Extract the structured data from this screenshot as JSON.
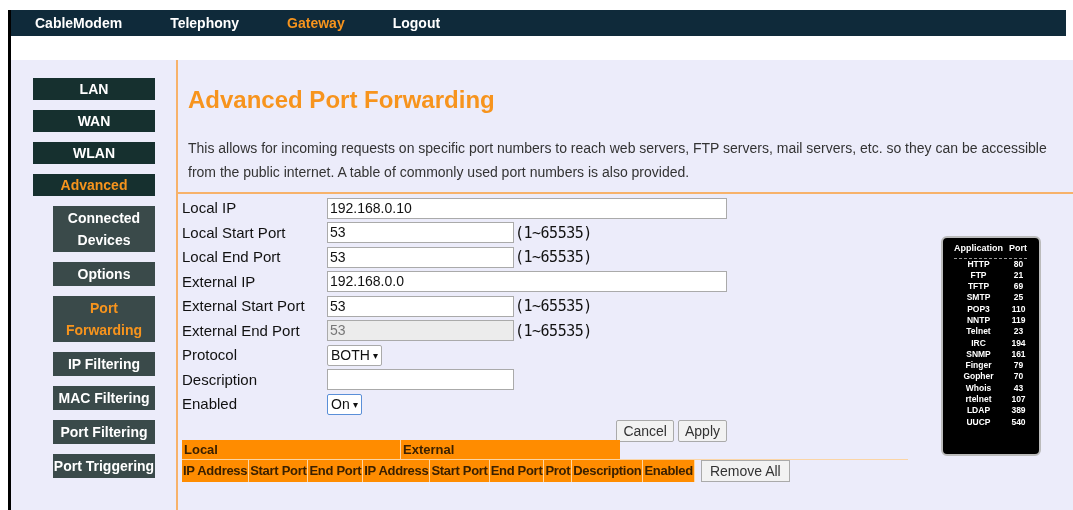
{
  "nav": [
    {
      "label": "CableModem",
      "selected": false
    },
    {
      "label": "Telephony",
      "selected": false
    },
    {
      "label": "Gateway",
      "selected": true
    },
    {
      "label": "Logout",
      "selected": false
    }
  ],
  "sidebar": {
    "items": [
      {
        "label": "LAN",
        "selected": false
      },
      {
        "label": "WAN",
        "selected": false
      },
      {
        "label": "WLAN",
        "selected": false
      },
      {
        "label": "Advanced",
        "selected": true,
        "children": [
          {
            "label": "Connected Devices",
            "selected": false
          },
          {
            "label": "Options",
            "selected": false
          },
          {
            "label": "Port Forwarding",
            "selected": true
          },
          {
            "label": "IP Filtering",
            "selected": false
          },
          {
            "label": "MAC Filtering",
            "selected": false
          },
          {
            "label": "Port Filtering",
            "selected": false
          },
          {
            "label": "Port Triggering",
            "selected": false
          }
        ]
      }
    ]
  },
  "title": "Advanced Port Forwarding",
  "description": "This allows for incoming requests on specific port numbers to reach web servers, FTP servers, mail servers, etc. so they can be accessible from the public internet. A table of commonly used port numbers is also provided.",
  "form": [
    {
      "label": "Local IP",
      "kind": "wide",
      "value": "192.168.0.10",
      "disabled": false,
      "focused": false
    },
    {
      "label": "Local Start Port",
      "kind": "text",
      "value": "53",
      "hint": "(1~65535)",
      "disabled": false,
      "focused": false
    },
    {
      "label": "Local End Port",
      "kind": "text",
      "value": "53",
      "hint": "(1~65535)",
      "disabled": false,
      "focused": false
    },
    {
      "label": "External IP",
      "kind": "wide",
      "value": "192.168.0.0",
      "disabled": false,
      "focused": false
    },
    {
      "label": "External Start Port",
      "kind": "text",
      "value": "53",
      "hint": "(1~65535)",
      "disabled": false,
      "focused": false
    },
    {
      "label": "External End Port",
      "kind": "text",
      "value": "53",
      "hint": "(1~65535)",
      "disabled": true,
      "focused": false
    },
    {
      "label": "Protocol",
      "kind": "select",
      "value": "BOTH",
      "arrow": "▾",
      "disabled": false,
      "focused": false
    },
    {
      "label": "Description",
      "kind": "text",
      "disabled": false,
      "focused": false
    },
    {
      "label": "Enabled",
      "kind": "select",
      "value": "On",
      "arrow": "▾",
      "disabled": false,
      "focused": true
    }
  ],
  "buttons": [
    "Cancel",
    "Apply"
  ],
  "table": {
    "groups": [
      "Local",
      "External"
    ],
    "columns": [
      "IP Address",
      "Start Port",
      "End Port",
      "IP Address",
      "Start Port",
      "End Port",
      "Prot",
      "Description",
      "Enabled"
    ],
    "action": "Remove All"
  },
  "port_reference": {
    "columns": [
      "Application",
      "Port"
    ],
    "rows": [
      [
        "HTTP",
        "80"
      ],
      [
        "FTP",
        "21"
      ],
      [
        "TFTP",
        "69"
      ],
      [
        "SMTP",
        "25"
      ],
      [
        "POP3",
        "110"
      ],
      [
        "NNTP",
        "119"
      ],
      [
        "Telnet",
        "23"
      ],
      [
        "IRC",
        "194"
      ],
      [
        "SNMP",
        "161"
      ],
      [
        "Finger",
        "79"
      ],
      [
        "Gopher",
        "70"
      ],
      [
        "Whois",
        "43"
      ],
      [
        "rtelnet",
        "107"
      ],
      [
        "LDAP",
        "389"
      ],
      [
        "UUCP",
        "540"
      ]
    ]
  }
}
